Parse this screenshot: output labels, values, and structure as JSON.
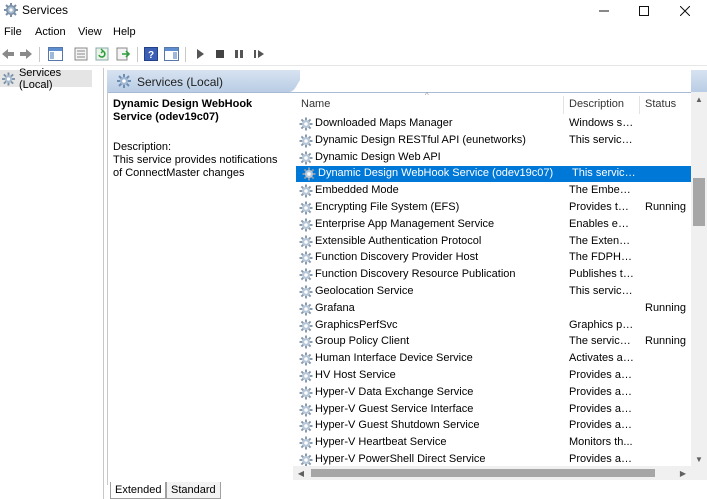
{
  "window": {
    "title": "Services",
    "minimize_icon": "minimize-icon",
    "maximize_icon": "maximize-icon",
    "close_icon": "close-icon"
  },
  "menu": [
    "File",
    "Action",
    "View",
    "Help"
  ],
  "tree": {
    "label": "Services (Local)"
  },
  "pane": {
    "title": "Services (Local)"
  },
  "details": {
    "service_title": "Dynamic Design WebHook Service (odev19c07)",
    "description_label": "Description:",
    "description_text": "This service provides notifications of ConnectMaster changes"
  },
  "columns": {
    "name": "Name",
    "description": "Description",
    "status": "Status"
  },
  "rows": [
    {
      "name": "Downloaded Maps Manager",
      "description": "Windows ser...",
      "status": ""
    },
    {
      "name": "Dynamic Design RESTful API (eunetworks)",
      "description": "This service ...",
      "status": ""
    },
    {
      "name": "Dynamic Design Web API",
      "description": "",
      "status": ""
    },
    {
      "name": "Dynamic Design WebHook Service (odev19c07)",
      "description": "This service ...",
      "status": "",
      "selected": true
    },
    {
      "name": "Embedded Mode",
      "description": "The Embedd...",
      "status": ""
    },
    {
      "name": "Encrypting File System (EFS)",
      "description": "Provides the...",
      "status": "Running"
    },
    {
      "name": "Enterprise App Management Service",
      "description": "Enables ente...",
      "status": ""
    },
    {
      "name": "Extensible Authentication Protocol",
      "description": "The Extensib...",
      "status": ""
    },
    {
      "name": "Function Discovery Provider Host",
      "description": "The FDPHOS...",
      "status": ""
    },
    {
      "name": "Function Discovery Resource Publication",
      "description": "Publishes thi...",
      "status": ""
    },
    {
      "name": "Geolocation Service",
      "description": "This service ...",
      "status": ""
    },
    {
      "name": "Grafana",
      "description": "",
      "status": "Running"
    },
    {
      "name": "GraphicsPerfSvc",
      "description": "Graphics per...",
      "status": ""
    },
    {
      "name": "Group Policy Client",
      "description": "The service i...",
      "status": "Running"
    },
    {
      "name": "Human Interface Device Service",
      "description": "Activates an...",
      "status": ""
    },
    {
      "name": "HV Host Service",
      "description": "Provides an i...",
      "status": ""
    },
    {
      "name": "Hyper-V Data Exchange Service",
      "description": "Provides a m...",
      "status": ""
    },
    {
      "name": "Hyper-V Guest Service Interface",
      "description": "Provides an i...",
      "status": ""
    },
    {
      "name": "Hyper-V Guest Shutdown Service",
      "description": "Provides a m...",
      "status": ""
    },
    {
      "name": "Hyper-V Heartbeat Service",
      "description": "Monitors th...",
      "status": ""
    },
    {
      "name": "Hyper-V PowerShell Direct Service",
      "description": "Provides a m...",
      "status": ""
    }
  ],
  "tabs": [
    "Extended",
    "Standard"
  ],
  "colors": {
    "selection": "#0078d7",
    "header_gradient_top": "#d7e3f1",
    "header_gradient_bottom": "#b9cde4"
  }
}
